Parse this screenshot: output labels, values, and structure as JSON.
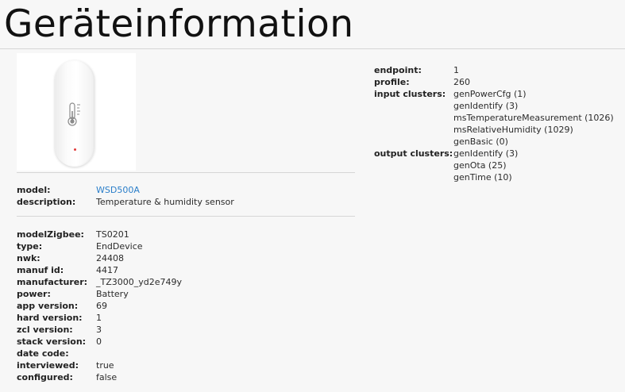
{
  "title": "Geräteinformation",
  "device": {
    "model_label": "model:",
    "model": "WSD500A",
    "description_label": "description:",
    "description": "Temperature & humidity sensor"
  },
  "details": [
    {
      "key": "modelZigbee:",
      "value": "TS0201"
    },
    {
      "key": "type:",
      "value": "EndDevice"
    },
    {
      "key": "nwk:",
      "value": "24408"
    },
    {
      "key": "manuf id:",
      "value": "4417"
    },
    {
      "key": "manufacturer:",
      "value": "_TZ3000_yd2e749y"
    },
    {
      "key": "power:",
      "value": "Battery"
    },
    {
      "key": "app version:",
      "value": "69"
    },
    {
      "key": "hard version:",
      "value": "1"
    },
    {
      "key": "zcl version:",
      "value": "3"
    },
    {
      "key": "stack version:",
      "value": "0"
    },
    {
      "key": "date code:",
      "value": ""
    },
    {
      "key": "interviewed:",
      "value": "true"
    },
    {
      "key": "configured:",
      "value": "false"
    }
  ],
  "endpoint": {
    "endpoint_label": "endpoint:",
    "endpoint": "1",
    "profile_label": "profile:",
    "profile": "260",
    "input_label": "input clusters:",
    "input_clusters": [
      "genPowerCfg (1)",
      "genIdentify (3)",
      "msTemperatureMeasurement (1026)",
      "msRelativeHumidity (1029)",
      "genBasic (0)"
    ],
    "output_label": "output clusters:",
    "output_clusters": [
      "genIdentify (3)",
      "genOta (25)",
      "genTime (10)"
    ]
  },
  "icons": {
    "device_image": "temperature-sensor-image",
    "thermometer": "thermometer-icon"
  },
  "colors": {
    "link": "#2a7ec9",
    "background": "#f7f7f7"
  }
}
